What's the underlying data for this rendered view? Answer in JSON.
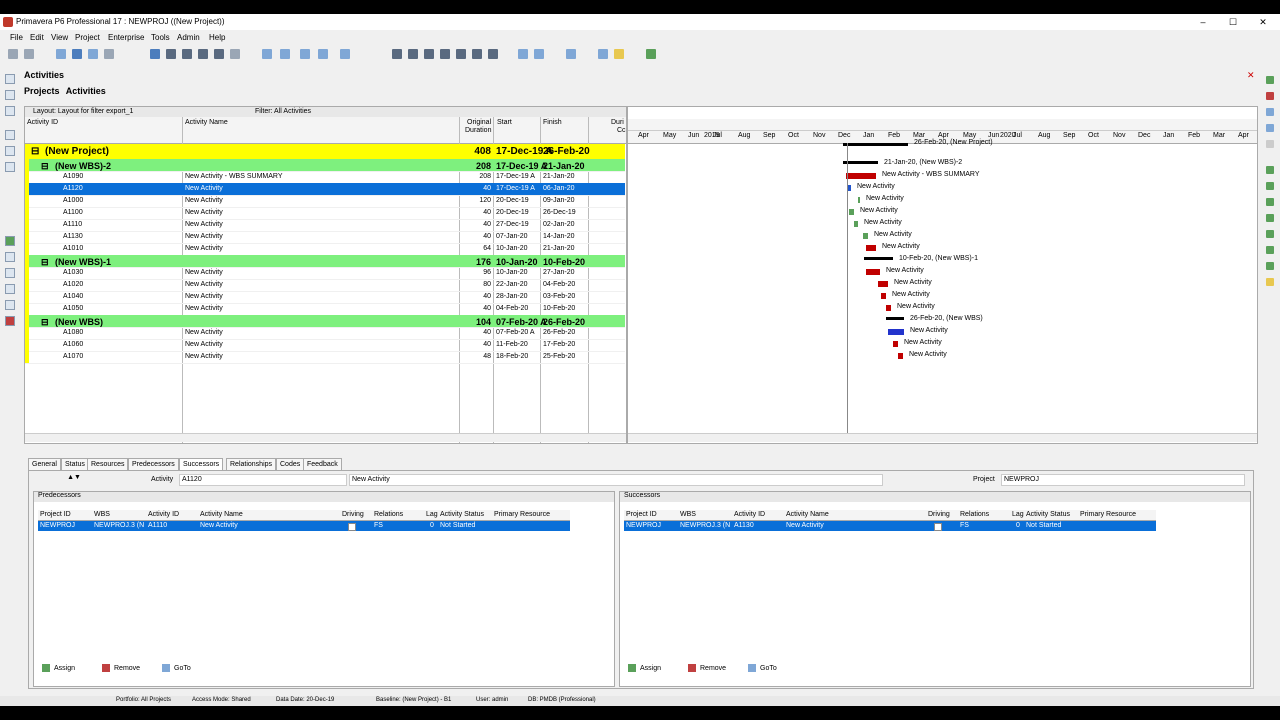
{
  "window": {
    "title": "Primavera P6 Professional 17 : NEWPROJ ((New Project))"
  },
  "menu": [
    "File",
    "Edit",
    "View",
    "Project",
    "Enterprise",
    "Tools",
    "Admin",
    "Help"
  ],
  "panel": {
    "title": "Activities",
    "tab_projects": "Projects",
    "tab_activities": "Activities"
  },
  "layout": {
    "label": "Layout: Layout for filter export_1",
    "filter": "Filter: All Activities"
  },
  "columns": {
    "activity_id": "Activity ID",
    "activity_name": "Activity Name",
    "orig_duration_1": "Original",
    "orig_duration_2": "Duration",
    "start": "Start",
    "finish": "Finish",
    "duration_1": "Duri",
    "duration_2": "Cc"
  },
  "rows": [
    {
      "type": "proj",
      "id": "(New Project)",
      "name": "",
      "dur": "408",
      "start": "17-Dec-19 A",
      "finish": "26-Feb-20"
    },
    {
      "type": "wbs",
      "id": "(New WBS)-2",
      "name": "",
      "dur": "208",
      "start": "17-Dec-19 A",
      "finish": "21-Jan-20"
    },
    {
      "type": "act",
      "id": "A1090",
      "name": "New Activity - WBS SUMMARY",
      "dur": "208",
      "start": "17-Dec-19 A",
      "finish": "21-Jan-20"
    },
    {
      "type": "sel",
      "id": "A1120",
      "name": "New Activity",
      "dur": "40",
      "start": "17-Dec-19 A",
      "finish": "06-Jan-20"
    },
    {
      "type": "act",
      "id": "A1000",
      "name": "New Activity",
      "dur": "120",
      "start": "20-Dec-19",
      "finish": "09-Jan-20"
    },
    {
      "type": "act",
      "id": "A1100",
      "name": "New Activity",
      "dur": "40",
      "start": "20-Dec-19",
      "finish": "26-Dec-19"
    },
    {
      "type": "act",
      "id": "A1110",
      "name": "New Activity",
      "dur": "40",
      "start": "27-Dec-19",
      "finish": "02-Jan-20"
    },
    {
      "type": "act",
      "id": "A1130",
      "name": "New Activity",
      "dur": "40",
      "start": "07-Jan-20",
      "finish": "14-Jan-20"
    },
    {
      "type": "act",
      "id": "A1010",
      "name": "New Activity",
      "dur": "64",
      "start": "10-Jan-20",
      "finish": "21-Jan-20"
    },
    {
      "type": "wbs",
      "id": "(New WBS)-1",
      "name": "",
      "dur": "176",
      "start": "10-Jan-20",
      "finish": "10-Feb-20"
    },
    {
      "type": "act",
      "id": "A1030",
      "name": "New Activity",
      "dur": "96",
      "start": "10-Jan-20",
      "finish": "27-Jan-20"
    },
    {
      "type": "act",
      "id": "A1020",
      "name": "New Activity",
      "dur": "80",
      "start": "22-Jan-20",
      "finish": "04-Feb-20"
    },
    {
      "type": "act",
      "id": "A1040",
      "name": "New Activity",
      "dur": "40",
      "start": "28-Jan-20",
      "finish": "03-Feb-20"
    },
    {
      "type": "act",
      "id": "A1050",
      "name": "New Activity",
      "dur": "40",
      "start": "04-Feb-20",
      "finish": "10-Feb-20"
    },
    {
      "type": "wbs",
      "id": "(New WBS)",
      "name": "",
      "dur": "104",
      "start": "07-Feb-20 A",
      "finish": "26-Feb-20"
    },
    {
      "type": "act",
      "id": "A1080",
      "name": "New Activity",
      "dur": "40",
      "start": "07-Feb-20 A",
      "finish": "26-Feb-20"
    },
    {
      "type": "act",
      "id": "A1060",
      "name": "New Activity",
      "dur": "40",
      "start": "11-Feb-20",
      "finish": "17-Feb-20"
    },
    {
      "type": "act",
      "id": "A1070",
      "name": "New Activity",
      "dur": "48",
      "start": "18-Feb-20",
      "finish": "25-Feb-20"
    }
  ],
  "gantt": {
    "years": [
      "2019",
      "2020"
    ],
    "months": [
      "Apr",
      "May",
      "Jun",
      "Jul",
      "Aug",
      "Sep",
      "Oct",
      "Nov",
      "Dec",
      "Jan",
      "Feb",
      "Mar",
      "Apr",
      "May",
      "Jun",
      "Jul",
      "Aug",
      "Sep",
      "Oct",
      "Nov",
      "Dec",
      "Jan",
      "Feb",
      "Mar",
      "Apr"
    ],
    "labels": [
      "26-Feb-20, (New Project)",
      "21-Jan-20, (New WBS)-2",
      "New Activity - WBS SUMMARY",
      "New Activity",
      "New Activity",
      "New Activity",
      "New Activity",
      "New Activity",
      "New Activity",
      "10-Feb-20, (New WBS)-1",
      "New Activity",
      "New Activity",
      "New Activity",
      "New Activity",
      "26-Feb-20, (New WBS)",
      "New Activity",
      "New Activity",
      "New Activity"
    ]
  },
  "bottom": {
    "tabs": [
      "General",
      "Status",
      "Resources",
      "Predecessors",
      "Successors",
      "Relationships",
      "Codes",
      "Feedback"
    ],
    "activity_label": "Activity",
    "activity_id": "A1120",
    "activity_name": "New Activity",
    "project_label": "Project",
    "project_value": "NEWPROJ",
    "pred_title": "Predecessors",
    "succ_title": "Successors",
    "rel_headers": [
      "Project ID",
      "WBS",
      "Activity ID",
      "Activity Name",
      "Driving",
      "Relations",
      "Lag",
      "Activity Status",
      "Primary Resource"
    ],
    "pred_row": [
      "NEWPROJ",
      "NEWPROJ.3 (N",
      "A1110",
      "New Activity",
      "",
      "FS",
      "0",
      "Not Started",
      ""
    ],
    "succ_row": [
      "NEWPROJ",
      "NEWPROJ.3 (N",
      "A1130",
      "New Activity",
      "",
      "FS",
      "0",
      "Not Started",
      ""
    ],
    "assign": "Assign",
    "remove": "Remove",
    "goto": "GoTo"
  },
  "status": {
    "portfolio": "Portfolio: All Projects",
    "access": "Access Mode: Shared",
    "data_date": "Data Date: 20-Dec-19",
    "baseline": "Baseline: (New Project) - B1",
    "user": "User: admin",
    "db": "DB: PMDB (Professional)"
  }
}
